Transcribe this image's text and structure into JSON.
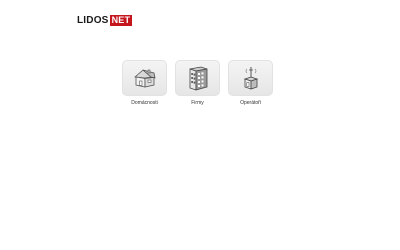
{
  "logo": {
    "part1": "LIDOS",
    "part2": "NET",
    "accent_color": "#c4161c"
  },
  "tiles": [
    {
      "label": "Domácnosti",
      "icon": "house-icon"
    },
    {
      "label": "Firmy",
      "icon": "building-icon"
    },
    {
      "label": "Operátoři",
      "icon": "antenna-tower-icon"
    }
  ]
}
